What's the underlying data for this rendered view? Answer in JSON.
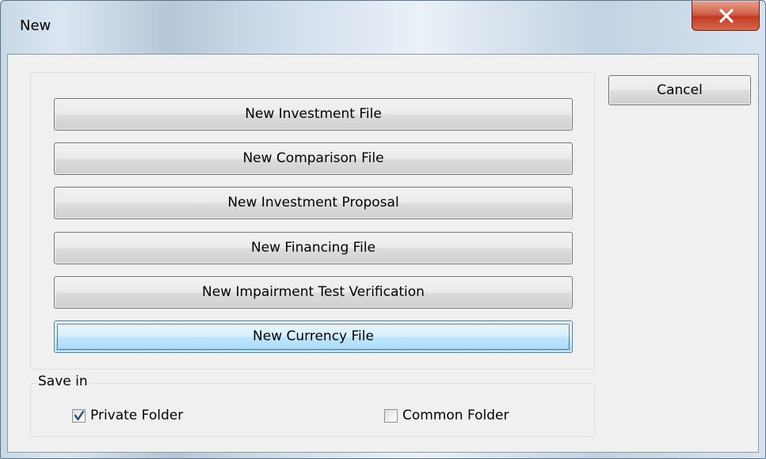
{
  "window": {
    "title": "New",
    "close_icon": "close-icon",
    "close_color": "#c9442a"
  },
  "commands": [
    {
      "label": "New Investment File",
      "focused": false
    },
    {
      "label": "New Comparison File",
      "focused": false
    },
    {
      "label": "New Investment Proposal",
      "focused": false
    },
    {
      "label": "New Financing File",
      "focused": false
    },
    {
      "label": "New Impairment Test Verification",
      "focused": false
    },
    {
      "label": "New Currency File",
      "focused": true
    }
  ],
  "cancel_label": "Cancel",
  "save_in": {
    "legend": "Save in",
    "private_folder": {
      "label": "Private Folder",
      "checked": true
    },
    "common_folder": {
      "label": "Common Folder",
      "checked": false
    }
  }
}
